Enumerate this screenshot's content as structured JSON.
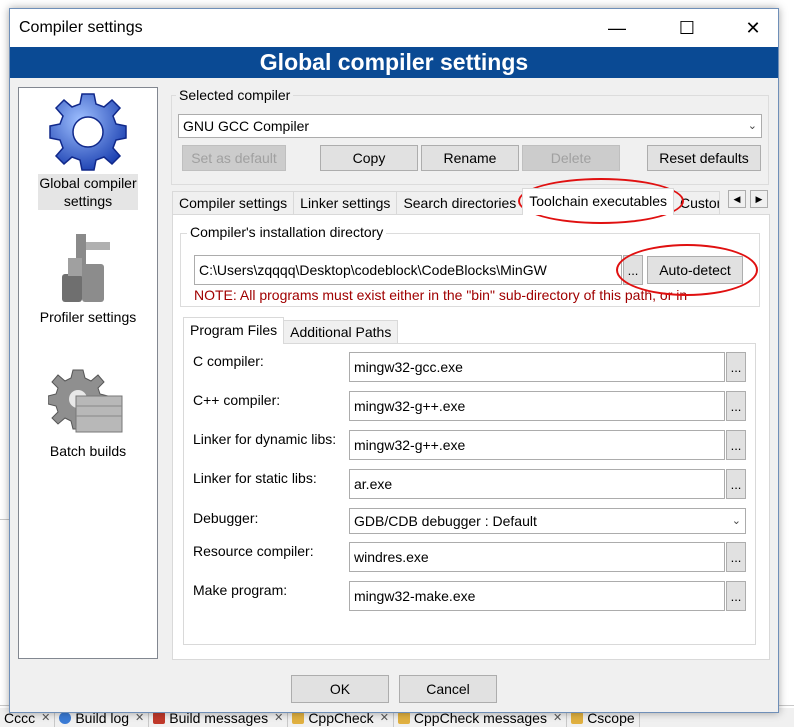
{
  "window": {
    "title": "Compiler settings",
    "minimize_glyph": "—",
    "maximize_glyph": "☐",
    "close_glyph": "✕",
    "banner": "Global compiler settings"
  },
  "sidebar": {
    "items": [
      {
        "label": "Global compiler settings",
        "icon": "gear-icon",
        "selected": true
      },
      {
        "label": "Profiler settings",
        "icon": "profiler-icon"
      },
      {
        "label": "Batch builds",
        "icon": "batch-builds-icon"
      }
    ]
  },
  "selected_compiler": {
    "legend": "Selected compiler",
    "value": "GNU GCC Compiler",
    "buttons": {
      "set_default": "Set as default",
      "copy": "Copy",
      "rename": "Rename",
      "delete": "Delete",
      "reset_defaults": "Reset defaults"
    }
  },
  "tabs": {
    "items": [
      "Compiler settings",
      "Linker settings",
      "Search directories",
      "Toolchain executables",
      "Custor"
    ],
    "active": "Toolchain executables"
  },
  "install_dir": {
    "legend": "Compiler's installation directory",
    "value": "C:\\Users\\zqqqq\\Desktop\\codeblock\\CodeBlocks\\MinGW",
    "browse": "...",
    "auto_detect": "Auto-detect",
    "note": "NOTE: All programs must exist either in the \"bin\" sub-directory of this path, or in"
  },
  "subtabs": {
    "items": [
      "Program Files",
      "Additional Paths"
    ],
    "active": "Program Files"
  },
  "programs": [
    {
      "label": "C compiler:",
      "value": "mingw32-gcc.exe",
      "type": "text"
    },
    {
      "label": "C++ compiler:",
      "value": "mingw32-g++.exe",
      "type": "text"
    },
    {
      "label": "Linker for dynamic libs:",
      "value": "mingw32-g++.exe",
      "type": "text"
    },
    {
      "label": "Linker for static libs:",
      "value": "ar.exe",
      "type": "text"
    },
    {
      "label": "Debugger:",
      "value": "GDB/CDB debugger : Default",
      "type": "select"
    },
    {
      "label": "Resource compiler:",
      "value": "windres.exe",
      "type": "text"
    },
    {
      "label": "Make program:",
      "value": "mingw32-make.exe",
      "type": "text"
    }
  ],
  "browse_label": "...",
  "footer": {
    "ok": "OK",
    "cancel": "Cancel"
  },
  "background_tabs": [
    {
      "label": "Cccc",
      "close": "✕",
      "icon_color": "#ffffff"
    },
    {
      "label": "Build log",
      "close": "✕",
      "icon_color": "#3a7bd5"
    },
    {
      "label": "Build messages",
      "close": "✕",
      "icon_color": "#c0392b"
    },
    {
      "label": "CppCheck",
      "close": "✕",
      "icon_color": "#e0b040"
    },
    {
      "label": "CppCheck messages",
      "close": "✕",
      "icon_color": "#e0b040"
    },
    {
      "label": "Cscope",
      "close": "",
      "icon_color": "#e0b040"
    }
  ],
  "colors": {
    "banner_bg": "#0a4a94",
    "annotation_red": "#e01010",
    "note_text": "#a00000"
  }
}
